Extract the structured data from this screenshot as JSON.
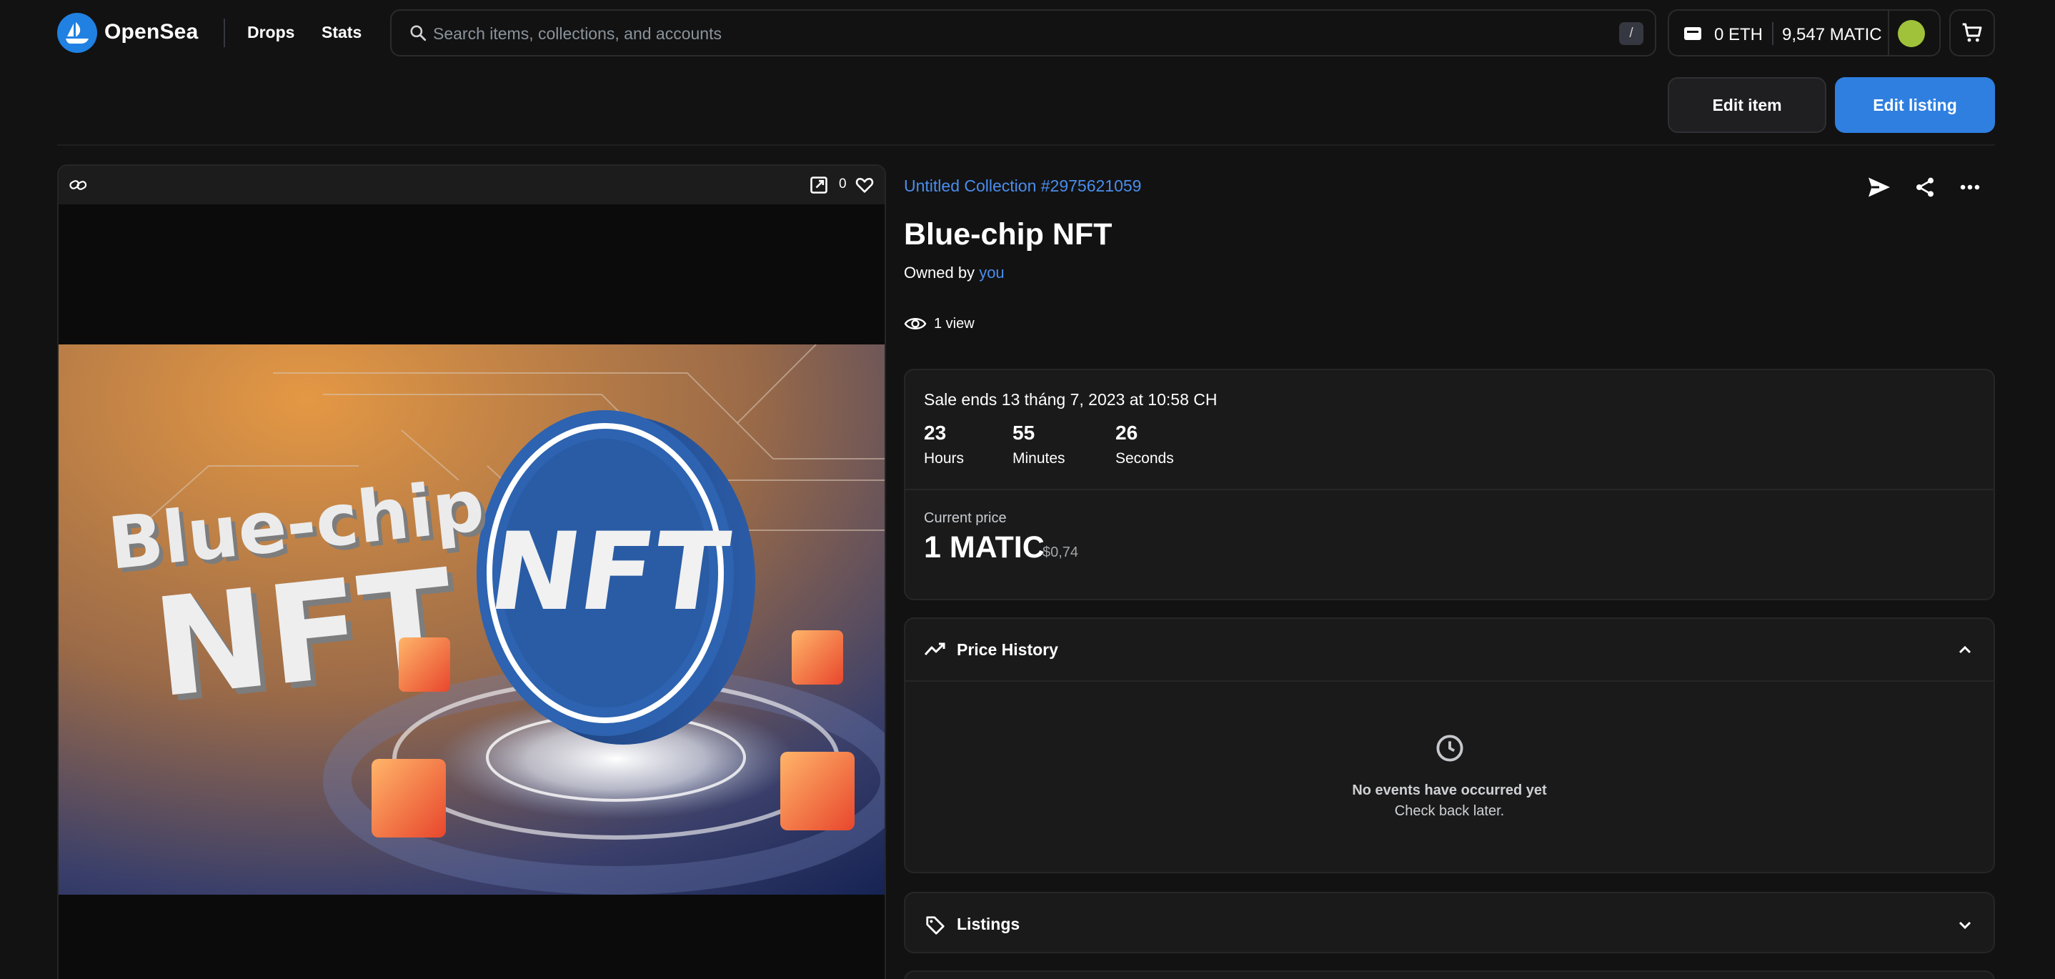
{
  "header": {
    "brand": "OpenSea",
    "nav": [
      "Drops",
      "Stats"
    ],
    "search_placeholder": "Search items, collections, and accounts",
    "search_shortcut": "/",
    "wallet_eth": "0 ETH",
    "wallet_matic": "9,547 MATIC"
  },
  "actions": {
    "edit_item": "Edit item",
    "edit_listing": "Edit listing"
  },
  "media": {
    "favorites_count": "0",
    "art_text_line1": "Blue-chip",
    "art_text_line2": "NFT",
    "coin_text": "NFT"
  },
  "item": {
    "collection": "Untitled Collection #2975621059",
    "title": "Blue-chip NFT",
    "owned_by_prefix": "Owned by",
    "owner": "you",
    "views": "1 view"
  },
  "sale": {
    "ends": "Sale ends 13 tháng 7, 2023 at 10:58 CH",
    "countdown": [
      {
        "value": "23",
        "label": "Hours"
      },
      {
        "value": "55",
        "label": "Minutes"
      },
      {
        "value": "26",
        "label": "Seconds"
      }
    ],
    "current_price_label": "Current price",
    "price": "1 MATIC",
    "price_usd": "$0,74"
  },
  "price_history": {
    "title": "Price History",
    "empty_title": "No events have occurred yet",
    "empty_sub": "Check back later."
  },
  "listings": {
    "title": "Listings"
  },
  "colors": {
    "accent": "#2081e2",
    "link": "#4a8ded",
    "background": "#121212",
    "card": "#1a1a1a"
  }
}
